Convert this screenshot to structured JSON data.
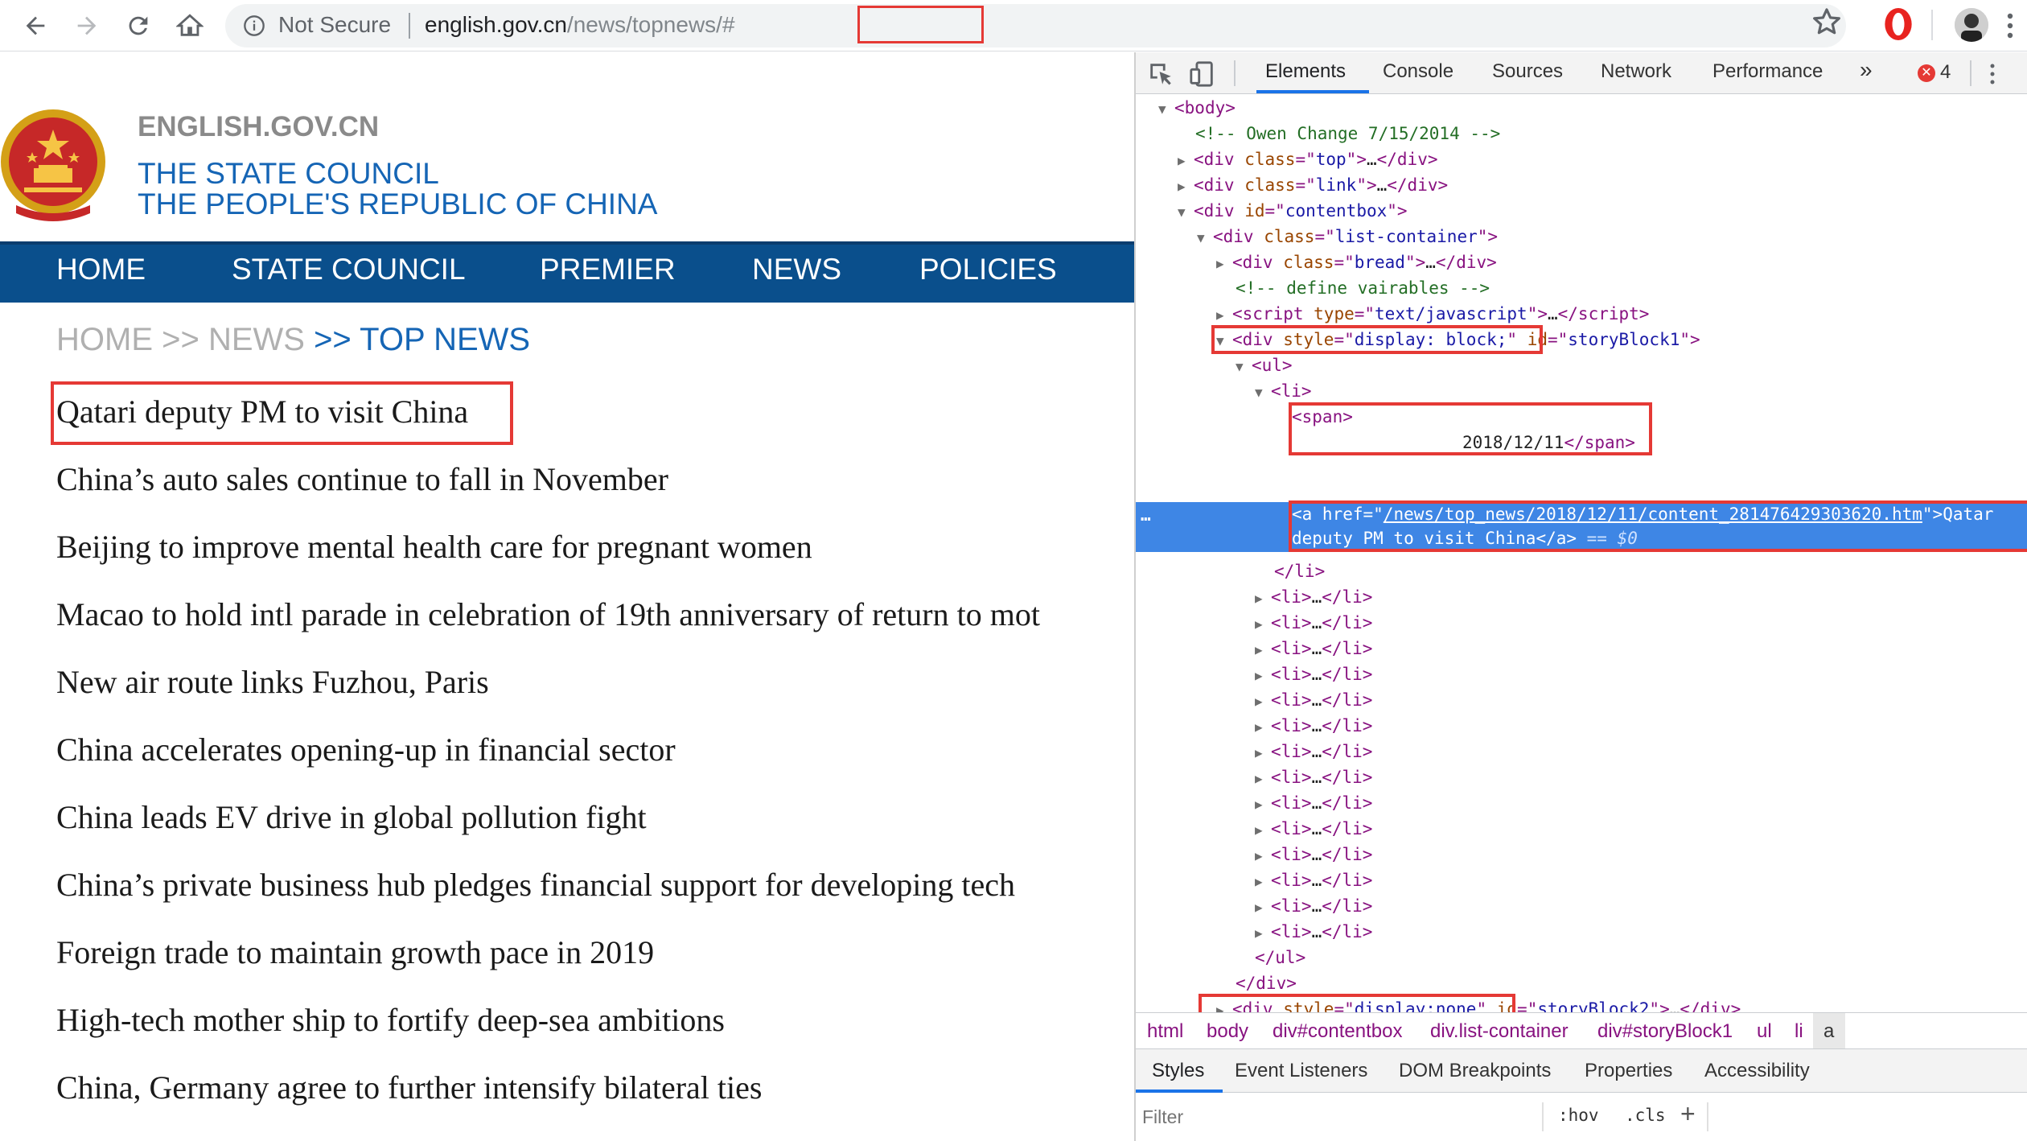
{
  "browser": {
    "security_label": "Not Secure",
    "url_host": "english.gov.cn",
    "url_path_prefix": "/news",
    "url_path_highlight": "/topnews/#"
  },
  "site": {
    "name": "ENGLISH.GOV.CN",
    "subtitle_1": "THE STATE COUNCIL",
    "subtitle_2": "THE PEOPLE'S REPUBLIC OF CHINA",
    "nav": [
      "HOME",
      "STATE COUNCIL",
      "PREMIER",
      "NEWS",
      "POLICIES"
    ],
    "breadcrumb": {
      "home": "HOME",
      "sep1": " >> ",
      "news": "NEWS",
      "current": " >> TOP NEWS"
    },
    "news": [
      "Qatari deputy PM to visit China",
      "China’s auto sales continue to fall in November",
      "Beijing to improve mental health care for pregnant women",
      "Macao to hold intl parade in celebration of 19th anniversary of return to mot",
      "New air route links Fuzhou, Paris",
      "China accelerates opening-up in financial sector",
      "China leads EV drive in global pollution fight",
      "China’s private business hub pledges financial support for developing tech",
      "Foreign trade to maintain growth pace in 2019",
      "High-tech mother ship to fortify deep-sea ambitions",
      "China, Germany agree to further intensify bilateral ties"
    ]
  },
  "devtools": {
    "tabs": [
      "Elements",
      "Console",
      "Sources",
      "Network",
      "Performance",
      "»"
    ],
    "error_count": "4",
    "dom": {
      "body": "body",
      "comment_owen": "<!-- Owen Change 7/15/2014 -->",
      "top_class": "top",
      "link_class": "link",
      "contentbox_id": "contentbox",
      "list_container_class": "list-container",
      "bread_class": "bread",
      "comment_define": "<!-- define vairables -->",
      "script_type": "text/javascript",
      "div_style_block": "display: block;",
      "story1_id": "storyBlock1",
      "span_text": "2018/12/11",
      "a_href": "/news/top_news/2018/12/11/content_281476429303620.htm",
      "a_text_1": "Qatar",
      "a_text_2": "deputy PM to visit China",
      "eq_label": "== $0",
      "li_count": 14,
      "style_none": "display:none",
      "story2_id": "storyBlock2",
      "story3_id": "storyBlock3",
      "story4_id": "storyBlock4"
    },
    "breadcrumbs": [
      "html",
      "body",
      "div#contentbox",
      "div.list-container",
      "div#storyBlock1",
      "ul",
      "li",
      "a"
    ],
    "subtabs": [
      "Styles",
      "Event Listeners",
      "DOM Breakpoints",
      "Properties",
      "Accessibility"
    ],
    "filter_placeholder": "Filter",
    "hov_label": ":hov",
    "cls_label": ".cls",
    "plus_label": "+"
  },
  "colors": {
    "nav_blue": "#0a4f8c",
    "link_blue": "#1565b5",
    "highlight_red": "#e53935",
    "selection_blue": "#3e86e5"
  },
  "icons": [
    "back-arrow-icon",
    "forward-arrow-icon",
    "reload-icon",
    "home-icon",
    "info-icon",
    "star-icon",
    "opera-icon",
    "avatar",
    "kebab-menu-icon",
    "inspect-icon",
    "device-toolbar-icon",
    "error-icon"
  ]
}
